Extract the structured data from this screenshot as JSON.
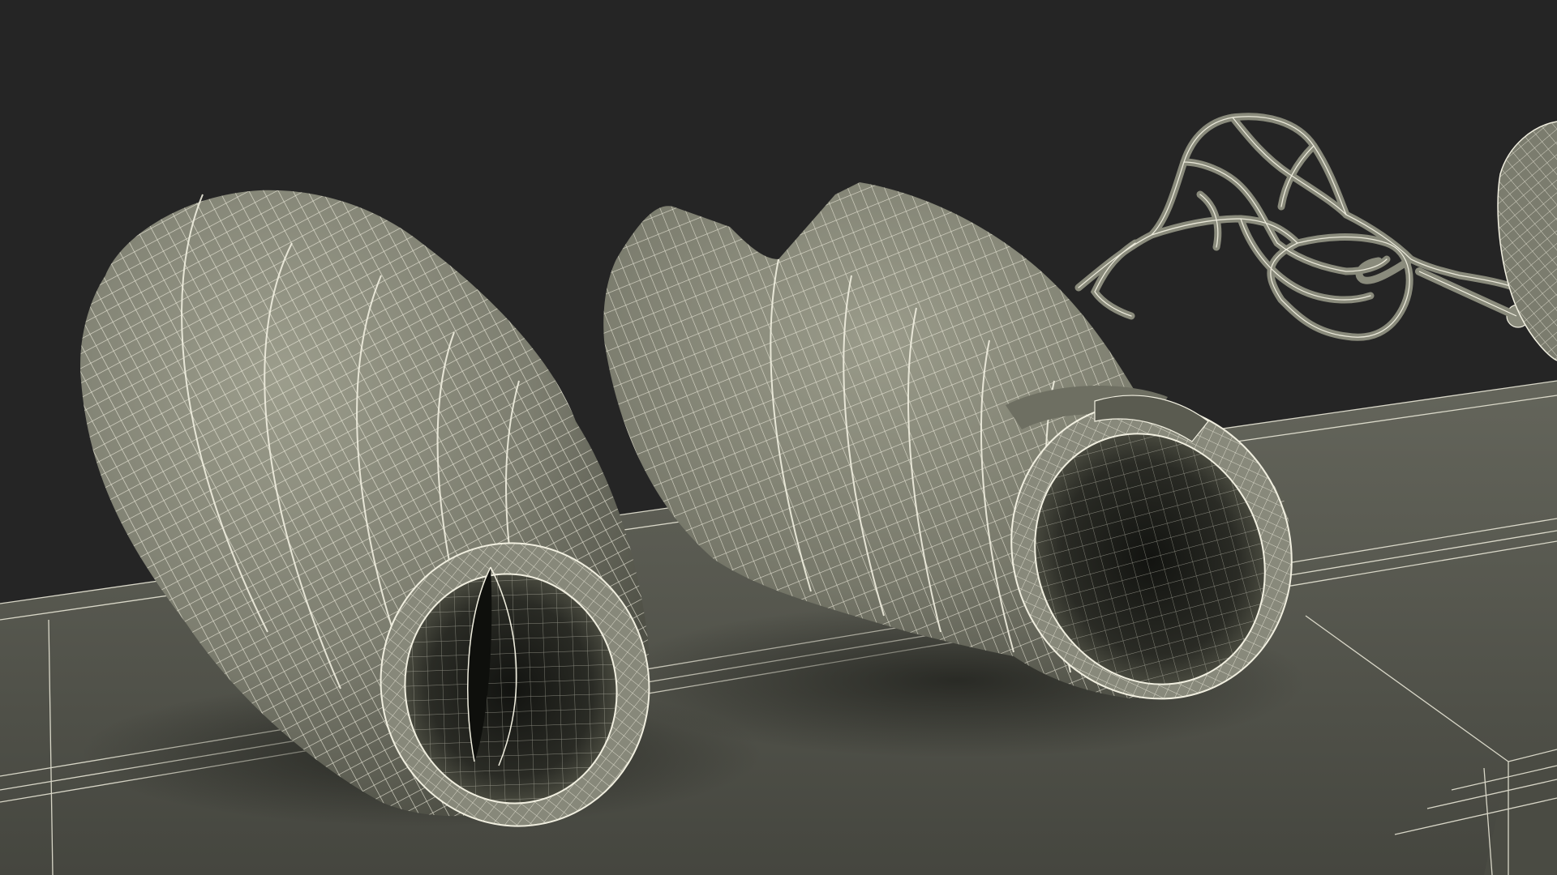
{
  "scene": {
    "kind": "3d-wireframe-render",
    "objects": [
      {
        "name": "airway-tube-segment-open-end"
      },
      {
        "name": "airway-tube-segment-with-branch-cuff"
      },
      {
        "name": "branching-mesh-structure"
      },
      {
        "name": "partial-object-cropped-right"
      }
    ]
  },
  "colors": {
    "background": "#252525",
    "floor_top": "#5d5e55",
    "floor_dark": "#3c3d36",
    "mesh_fill": "#7f8071",
    "mesh_shade": "#55564b",
    "mesh_highlight": "#a2a392",
    "interior_dark": "#1b1c18",
    "wire": "#f1efe0"
  }
}
